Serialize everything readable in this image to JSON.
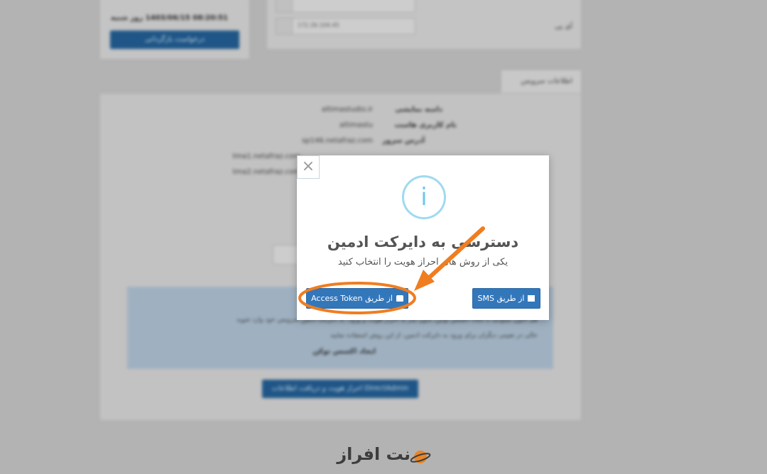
{
  "background": {
    "datetime": "08:20:51 1403/06/15 روز شنبه",
    "request_button": "درخواست بازگردانی",
    "ip_label": "آی پی",
    "ip_value": "172.26.104.45",
    "info_tab": "اطلاعات سرویس",
    "rows": [
      {
        "label": "دامنه نمایشی",
        "value": "altimastudio.ir"
      },
      {
        "label": "نام کاربری هاست",
        "value": "altimastu"
      },
      {
        "label": "آدرس سرور",
        "value": "sp146.netafraz.com"
      }
    ],
    "ns1": "tma1.netafraz.com",
    "ns2": "tma2.netafraz.com",
    "alert_line1": "هم اکنون میتوانید با ایجاد اکسس توکن، بدون نیاز به احراز هویت و ورود، به دایرکت ادمین سرویس خود وارد شوید",
    "alert_line2": "حالی در تعیینی دیگران برای ورود به دایرکت ادمین، از این روش استفاده نمایید",
    "alert_bold": "ایجاد اکسس توکن",
    "directadmin_button": "احراز هویت و دریافت اطلاعات DirectAdmin"
  },
  "modal": {
    "close_symbol": "×",
    "info_symbol": "i",
    "title": "دسترسی به دایرکت ادمین",
    "subtitle": "یکی از روش های احراز هویت را انتخاب کنید",
    "sms_button": "از طریق SMS",
    "token_button": "از طریق Access Token",
    "annotation_color": "#f07d20"
  },
  "logo": {
    "text": "نت افراز"
  }
}
